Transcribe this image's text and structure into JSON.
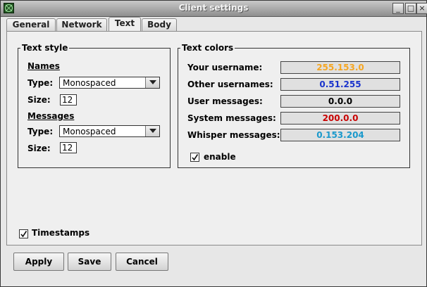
{
  "window": {
    "title": "Client settings",
    "controls": {
      "minimize": "_",
      "maximize": "□",
      "close": "×"
    }
  },
  "tabs": [
    {
      "label": "General",
      "active": false
    },
    {
      "label": "Network",
      "active": false
    },
    {
      "label": "Text",
      "active": true
    },
    {
      "label": "Body",
      "active": false
    }
  ],
  "text_style": {
    "legend": "Text style",
    "names": {
      "heading": "Names",
      "type_label": "Type:",
      "type_value": "Monospaced",
      "size_label": "Size:",
      "size_value": "12"
    },
    "messages": {
      "heading": "Messages",
      "type_label": "Type:",
      "type_value": "Monospaced",
      "size_label": "Size:",
      "size_value": "12"
    }
  },
  "text_colors": {
    "legend": "Text colors",
    "rows": [
      {
        "label": "Your username:",
        "value": "255.153.0",
        "color": "#f5a623"
      },
      {
        "label": "Other usernames:",
        "value": "0.51.255",
        "color": "#1a33cc"
      },
      {
        "label": "User messages:",
        "value": "0.0.0",
        "color": "#000000"
      },
      {
        "label": "System messages:",
        "value": "200.0.0",
        "color": "#c80000"
      },
      {
        "label": "Whisper messages:",
        "value": "0.153.204",
        "color": "#1a99cc"
      }
    ],
    "enable": {
      "label": "enable",
      "checked": true
    }
  },
  "timestamps": {
    "label": "Timestamps",
    "checked": true
  },
  "buttons": {
    "apply": "Apply",
    "save": "Save",
    "cancel": "Cancel"
  },
  "theme": {
    "accent_titlebar": "#9e9e9e",
    "panel_bg": "#efefef"
  }
}
